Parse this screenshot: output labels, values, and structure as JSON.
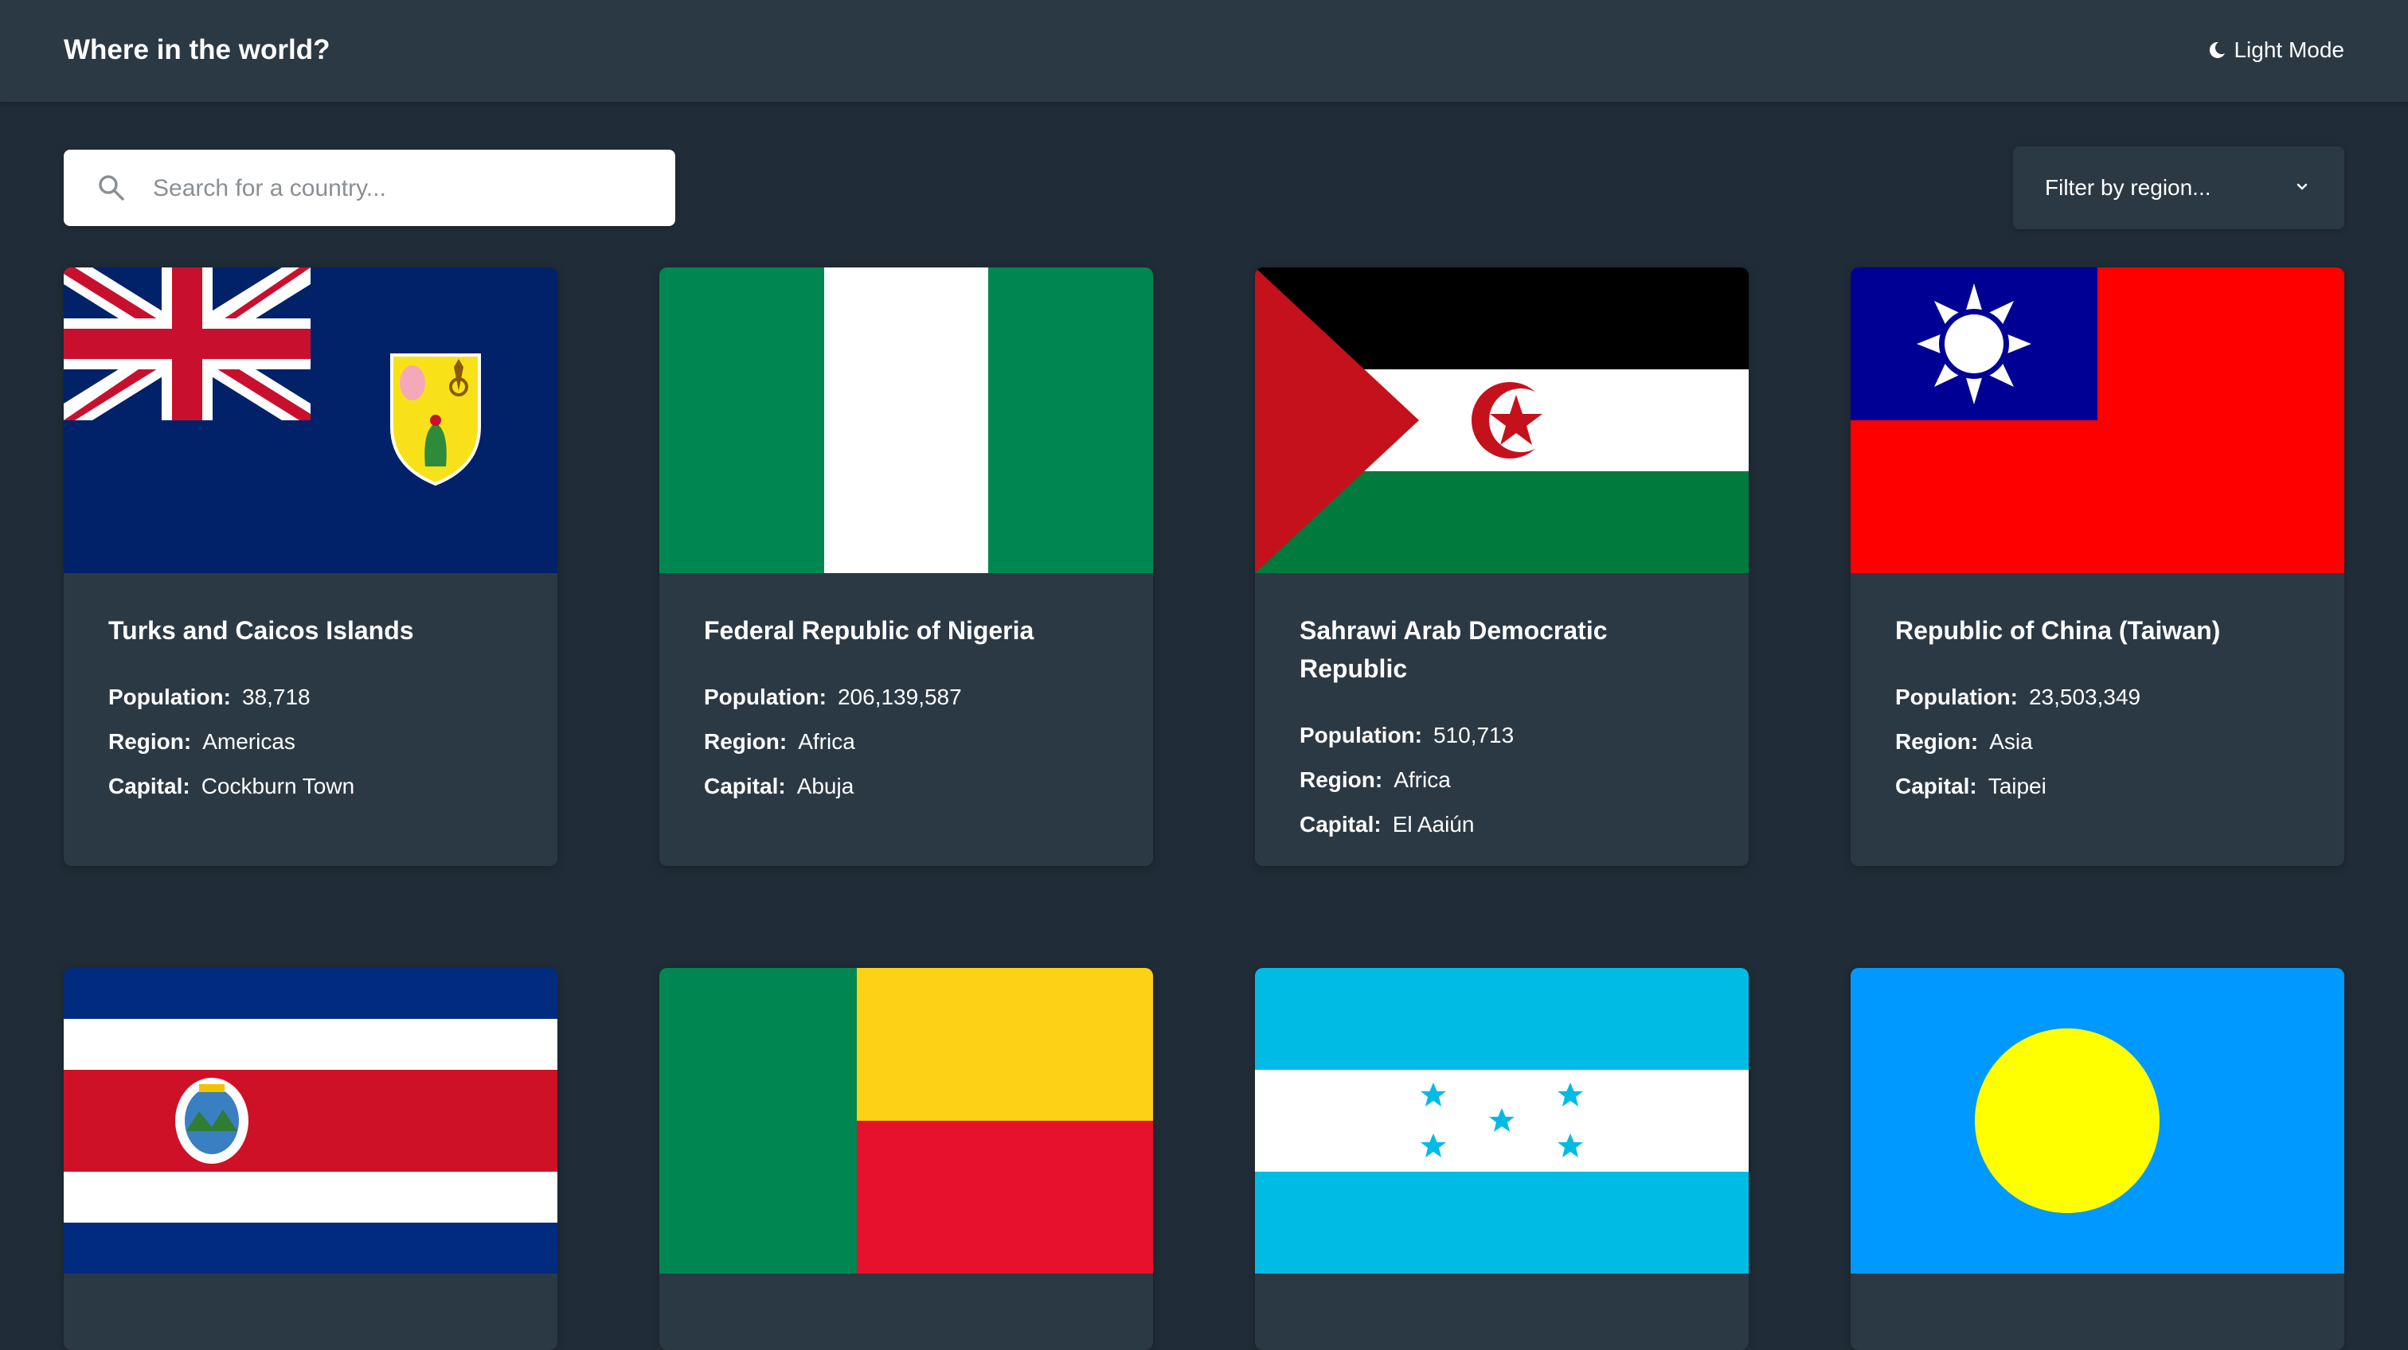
{
  "header": {
    "title": "Where in the world?",
    "theme_toggle_label": "Light Mode"
  },
  "search": {
    "placeholder": "Search for a country...",
    "value": ""
  },
  "filter": {
    "selected_label": "Filter by region..."
  },
  "labels": {
    "population": "Population:",
    "region": "Region:",
    "capital": "Capital:"
  },
  "countries": [
    {
      "name": "Turks and Caicos Islands",
      "population": "38,718",
      "region": "Americas",
      "capital": "Cockburn Town"
    },
    {
      "name": "Federal Republic of Nigeria",
      "population": "206,139,587",
      "region": "Africa",
      "capital": "Abuja"
    },
    {
      "name": "Sahrawi Arab Democratic Republic",
      "population": "510,713",
      "region": "Africa",
      "capital": "El Aaiún"
    },
    {
      "name": "Republic of China (Taiwan)",
      "population": "23,503,349",
      "region": "Asia",
      "capital": "Taipei"
    },
    {
      "name": "",
      "population": "",
      "region": "",
      "capital": ""
    },
    {
      "name": "",
      "population": "",
      "region": "",
      "capital": ""
    },
    {
      "name": "",
      "population": "",
      "region": "",
      "capital": ""
    },
    {
      "name": "",
      "population": "",
      "region": "",
      "capital": ""
    }
  ],
  "colors": {
    "background": "#202c37",
    "elements": "#2b3945",
    "text": "#ffffff"
  }
}
